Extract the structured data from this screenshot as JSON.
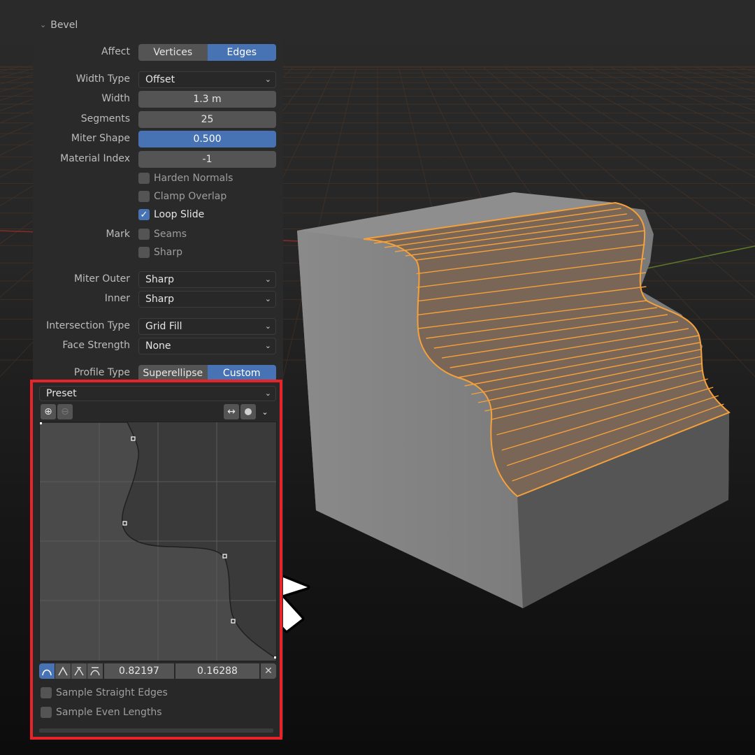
{
  "panel": {
    "title": "Bevel",
    "affect": {
      "label": "Affect",
      "options": [
        "Vertices",
        "Edges"
      ],
      "selected": "Edges"
    },
    "width_type": {
      "label": "Width Type",
      "value": "Offset"
    },
    "width": {
      "label": "Width",
      "value": "1.3 m"
    },
    "segments": {
      "label": "Segments",
      "value": "25"
    },
    "miter_shape": {
      "label": "Miter Shape",
      "value": "0.500"
    },
    "material_index": {
      "label": "Material Index",
      "value": "-1"
    },
    "harden_normals": {
      "label": "Harden Normals",
      "checked": false
    },
    "clamp_overlap": {
      "label": "Clamp Overlap",
      "checked": false
    },
    "loop_slide": {
      "label": "Loop Slide",
      "checked": true
    },
    "mark": {
      "label": "Mark",
      "seams": "Seams",
      "sharp": "Sharp"
    },
    "miter_outer": {
      "label": "Miter Outer",
      "value": "Sharp"
    },
    "inner": {
      "label": "Inner",
      "value": "Sharp"
    },
    "intersection_type": {
      "label": "Intersection Type",
      "value": "Grid Fill"
    },
    "face_strength": {
      "label": "Face Strength",
      "value": "None"
    },
    "profile_type": {
      "label": "Profile Type",
      "options": [
        "Superellipse",
        "Custom"
      ],
      "selected": "Custom"
    }
  },
  "curve_widget": {
    "preset_label": "Preset",
    "point_x": "0.82197",
    "point_y": "0.16288",
    "sample_straight_edges": "Sample Straight Edges",
    "sample_even_lengths": "Sample Even Lengths"
  },
  "colors": {
    "accent_blue": "#4772b3",
    "highlight_border": "#e8232a",
    "edge_orange": "#f5a13b"
  }
}
